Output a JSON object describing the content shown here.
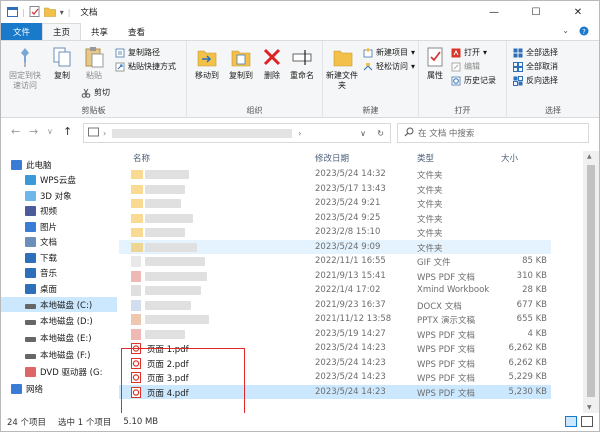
{
  "window": {
    "title": "文档"
  },
  "tabs": [
    "文件",
    "主页",
    "共享",
    "查看"
  ],
  "ribbon": {
    "clipboard": {
      "label": "剪贴板",
      "pin": "固定到快速访问",
      "copy": "复制",
      "paste": "粘贴",
      "copy_path": "复制路径",
      "paste_shortcut": "粘贴快捷方式",
      "cut": "剪切"
    },
    "organize": {
      "label": "组织",
      "move_to": "移动到",
      "copy_to": "复制到",
      "delete": "删除",
      "rename": "重命名"
    },
    "new": {
      "label": "新建",
      "new_folder": "新建文件夹",
      "new_item": "新建项目",
      "easy_access": "轻松访问"
    },
    "open": {
      "label": "打开",
      "properties": "属性",
      "open": "打开",
      "edit": "编辑",
      "history": "历史记录"
    },
    "select": {
      "label": "选择",
      "select_all": "全部选择",
      "select_none": "全部取消",
      "invert": "反向选择"
    }
  },
  "address": {
    "search_placeholder": "在 文档 中搜索"
  },
  "nav": [
    {
      "label": "此电脑",
      "icon": "pc-icon"
    },
    {
      "label": "WPS云盘",
      "icon": "cloud-icon"
    },
    {
      "label": "3D 对象",
      "icon": "cube-icon"
    },
    {
      "label": "视频",
      "icon": "video-icon"
    },
    {
      "label": "图片",
      "icon": "picture-icon"
    },
    {
      "label": "文档",
      "icon": "document-icon"
    },
    {
      "label": "下载",
      "icon": "download-icon"
    },
    {
      "label": "音乐",
      "icon": "music-icon"
    },
    {
      "label": "桌面",
      "icon": "desktop-icon"
    },
    {
      "label": "本地磁盘 (C:)",
      "icon": "drive-icon"
    },
    {
      "label": "本地磁盘 (D:)",
      "icon": "drive-icon"
    },
    {
      "label": "本地磁盘 (E:)",
      "icon": "drive-icon"
    },
    {
      "label": "本地磁盘 (F:)",
      "icon": "drive-icon"
    },
    {
      "label": "DVD 驱动器 (G:",
      "icon": "dvd-icon"
    },
    {
      "label": "网络",
      "icon": "network-icon"
    }
  ],
  "columns": {
    "name": "名称",
    "modified": "修改日期",
    "type": "类型",
    "size": "大小"
  },
  "files": [
    {
      "name": "",
      "modified": "2023/5/24 14:32",
      "type": "文件夹",
      "size": ""
    },
    {
      "name": "",
      "modified": "2023/5/17 13:43",
      "type": "文件夹",
      "size": ""
    },
    {
      "name": "",
      "modified": "2023/5/24 9:21",
      "type": "文件夹",
      "size": ""
    },
    {
      "name": "",
      "modified": "2023/5/24 9:25",
      "type": "文件夹",
      "size": ""
    },
    {
      "name": "",
      "modified": "2023/2/8 15:10",
      "type": "文件夹",
      "size": ""
    },
    {
      "name": "",
      "modified": "2023/5/24 9:09",
      "type": "文件夹",
      "size": ""
    },
    {
      "name": "",
      "modified": "2022/11/1 16:55",
      "type": "GIF 文件",
      "size": "85 KB"
    },
    {
      "name": "",
      "modified": "2021/9/13 15:41",
      "type": "WPS PDF 文档",
      "size": "310 KB"
    },
    {
      "name": "",
      "modified": "2022/1/4 17:02",
      "type": "Xmind Workbook",
      "size": "28 KB"
    },
    {
      "name": "",
      "modified": "2021/9/23 16:37",
      "type": "DOCX 文档",
      "size": "677 KB"
    },
    {
      "name": "",
      "modified": "2021/11/12 13:58",
      "type": "PPTX 演示文稿",
      "size": "655 KB"
    },
    {
      "name": "",
      "modified": "2023/5/19 14:27",
      "type": "WPS PDF 文档",
      "size": "4 KB"
    },
    {
      "name": "页面 1.pdf",
      "modified": "2023/5/24 14:23",
      "type": "WPS PDF 文档",
      "size": "6,262 KB"
    },
    {
      "name": "页面 2.pdf",
      "modified": "2023/5/24 14:23",
      "type": "WPS PDF 文档",
      "size": "6,262 KB"
    },
    {
      "name": "页面 3.pdf",
      "modified": "2023/5/24 14:23",
      "type": "WPS PDF 文档",
      "size": "5,229 KB"
    },
    {
      "name": "页面 4.pdf",
      "modified": "2023/5/24 14:23",
      "type": "WPS PDF 文档",
      "size": "5,230 KB"
    }
  ],
  "status": {
    "count": "24 个项目",
    "selected": "选中 1 个项目",
    "size": "5.10 MB"
  },
  "colors": {
    "accent": "#1979ca",
    "selection": "#cce8ff",
    "hover": "#e5f3ff",
    "highlight_box": "#e0292a",
    "folder": "#f3c14a",
    "pdf": "#d9352b"
  }
}
